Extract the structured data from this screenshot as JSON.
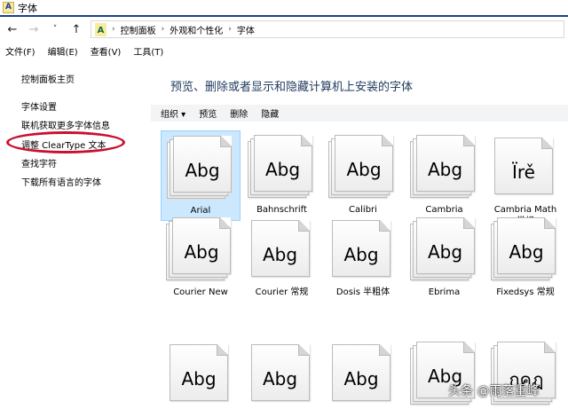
{
  "window": {
    "title": "字体"
  },
  "nav": {
    "back": "←",
    "forward": "→",
    "recent": "˅",
    "up": "↑",
    "breadcrumb": [
      "控制面板",
      "外观和个性化",
      "字体"
    ]
  },
  "menu": [
    "文件(F)",
    "编辑(E)",
    "查看(V)",
    "工具(T)"
  ],
  "sidebar": {
    "home": "控制面板主页",
    "items": [
      "字体设置",
      "联机获取更多字体信息",
      "调整 ClearType 文本",
      "查找字符",
      "下载所有语言的字体"
    ]
  },
  "main": {
    "heading": "预览、删除或者显示和隐藏计算机上安装的字体",
    "toolbar": [
      "组织 ▾",
      "预览",
      "删除",
      "隐藏"
    ]
  },
  "fonts": [
    {
      "name": "Arial",
      "sample": "Abg",
      "stacked": true,
      "selected": true
    },
    {
      "name": "Bahnschrift",
      "sample": "Abg",
      "stacked": true
    },
    {
      "name": "Calibri",
      "sample": "Abg",
      "stacked": true
    },
    {
      "name": "Cambria",
      "sample": "Abg",
      "stacked": true
    },
    {
      "name": "Cambria Math 常规",
      "sample": "Ïrě",
      "stacked": false
    },
    {
      "name": "Courier New",
      "sample": "Abg",
      "stacked": true
    },
    {
      "name": "Courier 常规",
      "sample": "Abg",
      "stacked": false
    },
    {
      "name": "Dosis 半粗体",
      "sample": "Abg",
      "stacked": false
    },
    {
      "name": "Ebrima",
      "sample": "Abg",
      "stacked": true
    },
    {
      "name": "Fixedsys 常规",
      "sample": "Abg",
      "stacked": true
    },
    {
      "name": "",
      "sample": "Abg",
      "stacked": false
    },
    {
      "name": "",
      "sample": "Abg",
      "stacked": false
    },
    {
      "name": "",
      "sample": "Abg",
      "stacked": false
    },
    {
      "name": "",
      "sample": "Abg",
      "stacked": true
    },
    {
      "name": "",
      "sample": "กคฎ",
      "stacked": true
    }
  ],
  "watermark": "头条 @雨落重峰"
}
